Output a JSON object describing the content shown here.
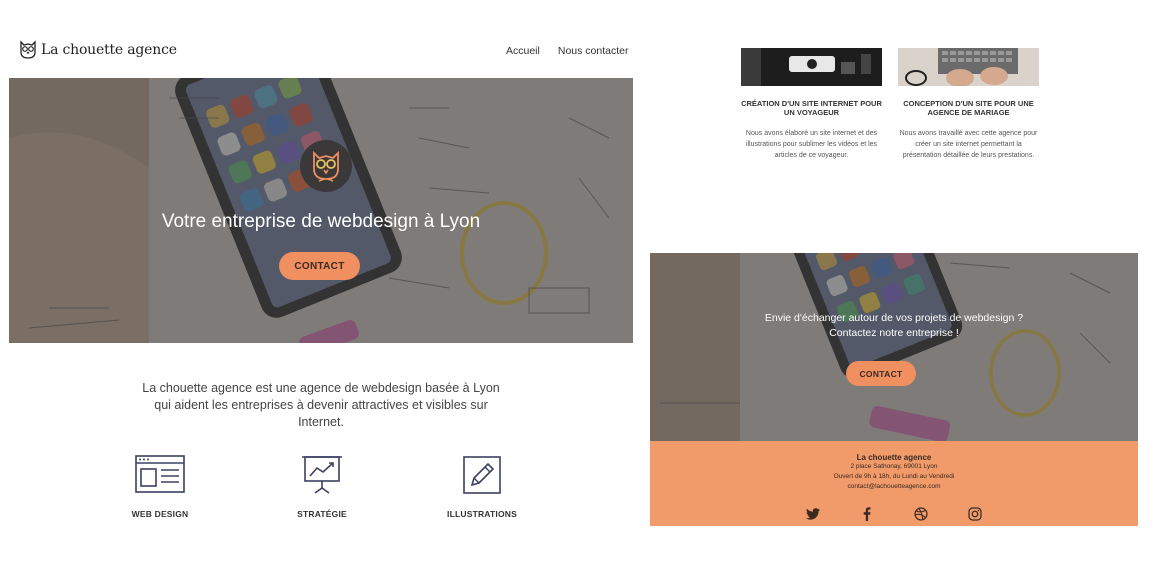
{
  "brand": {
    "name": "La chouette agence"
  },
  "nav": {
    "home": "Accueil",
    "contact": "Nous contacter"
  },
  "hero": {
    "title": "Votre entreprise de webdesign à Lyon",
    "cta": "CONTACT"
  },
  "intro": {
    "text": "La chouette agence est une agence de webdesign basée à Lyon qui aident les entreprises à devenir attractives et visibles sur Internet."
  },
  "services": [
    {
      "label": "WEB DESIGN",
      "icon": "web-design-icon"
    },
    {
      "label": "STRATÉGIE",
      "icon": "strategy-icon"
    },
    {
      "label": "ILLUSTRATIONS",
      "icon": "illustrations-icon"
    }
  ],
  "portfolio": [
    {
      "title": "CRÉATION D'UN SITE INTERNET POUR UN VOYAGEUR",
      "desc": "Nous avons élaboré un site internet et des illustrations pour sublimer les vidéos et les articles de ce voyageur."
    },
    {
      "title": "CONCEPTION D'UN SITE POUR UNE AGENCE DE MARIAGE",
      "desc": "Nous avons travaillé avec cette agence pour créer un site internet permettant la présentation détaillée de leurs prestations."
    }
  ],
  "cta": {
    "line1": "Envie d'échanger autour de vos projets de webdesign ?",
    "line2": "Contactez notre entreprise !",
    "button": "CONTACT"
  },
  "footer": {
    "name": "La chouette agence",
    "address": "2 place Sathonay, 69001 Lyon",
    "hours": "Ouvert de 9h à 18h, du Lundi au Vendredi",
    "email": "contact@lachouetteagence.com",
    "socials": [
      "twitter-icon",
      "facebook-icon",
      "dribbble-icon",
      "instagram-icon"
    ]
  },
  "colors": {
    "accent": "#f08f5f",
    "footer": "#f19a6a",
    "overlay": "#3c3a3a",
    "icon": "#3b4060"
  }
}
